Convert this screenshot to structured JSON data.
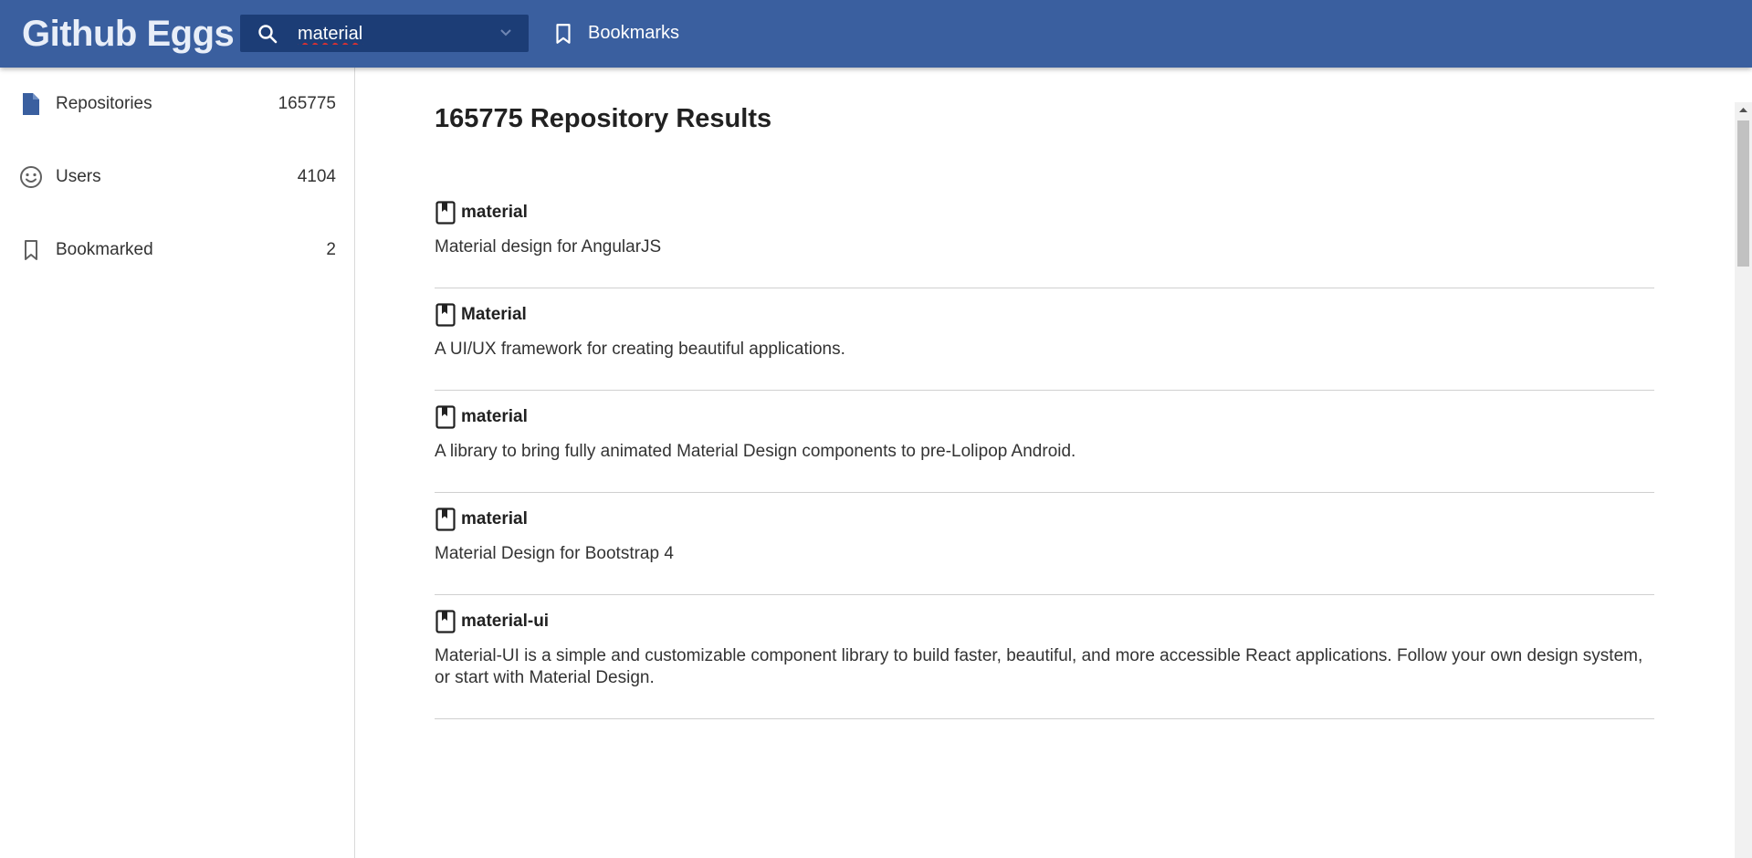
{
  "header": {
    "brand": "Github Eggs",
    "search": {
      "value": "material"
    },
    "bookmarks_label": "Bookmarks",
    "accent_color": "#3a5f9f"
  },
  "sidebar": {
    "items": [
      {
        "label": "Repositories",
        "count": "165775",
        "icon": "file-icon"
      },
      {
        "label": "Users",
        "count": "4104",
        "icon": "smiley-icon"
      },
      {
        "label": "Bookmarked",
        "count": "2",
        "icon": "bookmark-icon"
      }
    ]
  },
  "main": {
    "title": "165775 Repository Results",
    "results": [
      {
        "name": "material",
        "description": "Material design for AngularJS"
      },
      {
        "name": "Material",
        "description": "A UI/UX framework for creating beautiful applications."
      },
      {
        "name": "material",
        "description": "A library to bring fully animated Material Design components to pre-Lolipop Android."
      },
      {
        "name": "material",
        "description": "Material Design for Bootstrap 4"
      },
      {
        "name": "material-ui",
        "description": "Material-UI is a simple and customizable component library to build faster, beautiful, and more accessible React applications. Follow your own design system, or start with Material Design."
      }
    ]
  }
}
